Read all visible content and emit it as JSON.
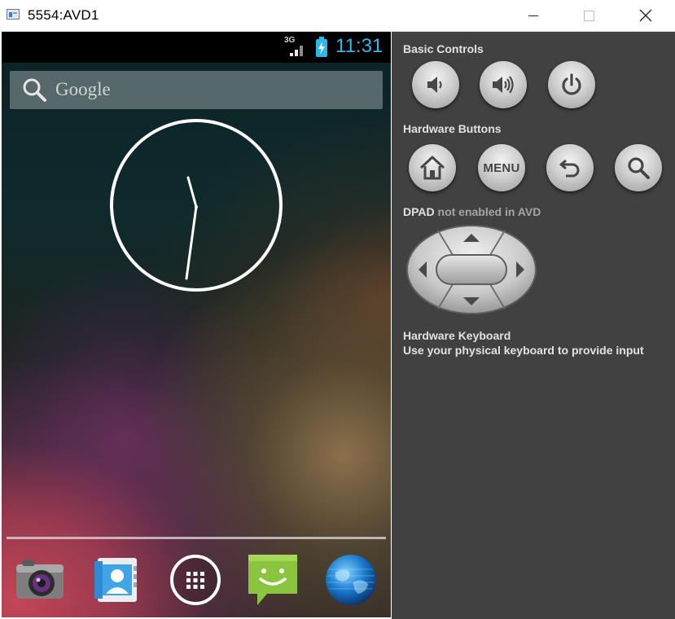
{
  "window": {
    "title": "5554:AVD1",
    "icon": "app-window-icon",
    "buttons": [
      "minimize-icon",
      "maximize-icon",
      "close-icon"
    ]
  },
  "device": {
    "statusbar": {
      "network": "3G",
      "time": "11:31",
      "accent": "#33b5e5"
    },
    "search": {
      "label": "Google"
    },
    "clock": {
      "hour": 11,
      "minute": 31
    },
    "dock": [
      "camera-icon",
      "contacts-icon",
      "all-apps-icon",
      "messaging-icon",
      "browser-icon"
    ]
  },
  "panel": {
    "basic_controls": {
      "title": "Basic Controls",
      "buttons": [
        "volume-down-icon",
        "volume-up-icon",
        "power-icon"
      ]
    },
    "hardware_buttons": {
      "title": "Hardware Buttons",
      "menu_label": "MENU",
      "buttons": [
        "home-icon",
        "menu",
        "back-icon",
        "search-icon"
      ]
    },
    "dpad": {
      "title": "DPAD",
      "note": "not enabled in AVD"
    },
    "keyboard": {
      "title": "Hardware Keyboard",
      "description": "Use your physical keyboard to provide input"
    }
  }
}
